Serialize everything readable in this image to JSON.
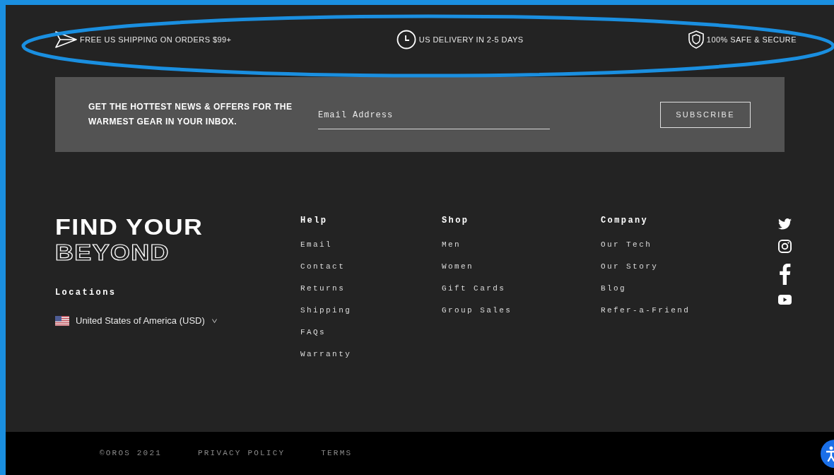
{
  "promo_bar": [
    {
      "kind": "shipping",
      "text": "FREE US SHIPPING ON ORDERS $99+"
    },
    {
      "kind": "delivery",
      "text": "US DELIVERY IN 2-5 DAYS"
    },
    {
      "kind": "security",
      "text": "100% SAFE & SECURE"
    }
  ],
  "newsletter": {
    "heading": "GET THE HOTTEST NEWS & OFFERS FOR THE WARMEST GEAR IN YOUR INBOX.",
    "placeholder": "Email Address",
    "button": "SUBSCRIBE"
  },
  "brand": {
    "line_1": "FIND YOUR",
    "line_2": "BEYOND"
  },
  "locations": {
    "heading": "Locations",
    "selected": "United States of America (USD)"
  },
  "link_columns": [
    {
      "heading": "Help",
      "links": [
        "Email",
        "Contact",
        "Returns",
        "Shipping",
        "FAQs",
        "Warranty"
      ]
    },
    {
      "heading": "Shop",
      "links": [
        "Men",
        "Women",
        "Gift Cards",
        "Group Sales"
      ]
    },
    {
      "heading": "Company",
      "links": [
        "Our Tech",
        "Our Story",
        "Blog",
        "Refer-a-Friend"
      ]
    }
  ],
  "social": [
    {
      "kind": "twitter"
    },
    {
      "kind": "instagram"
    },
    {
      "kind": "facebook"
    },
    {
      "kind": "youtube"
    }
  ],
  "bottom_bar": [
    "©OROS 2021",
    "PRIVACY POLICY",
    "TERMS"
  ]
}
